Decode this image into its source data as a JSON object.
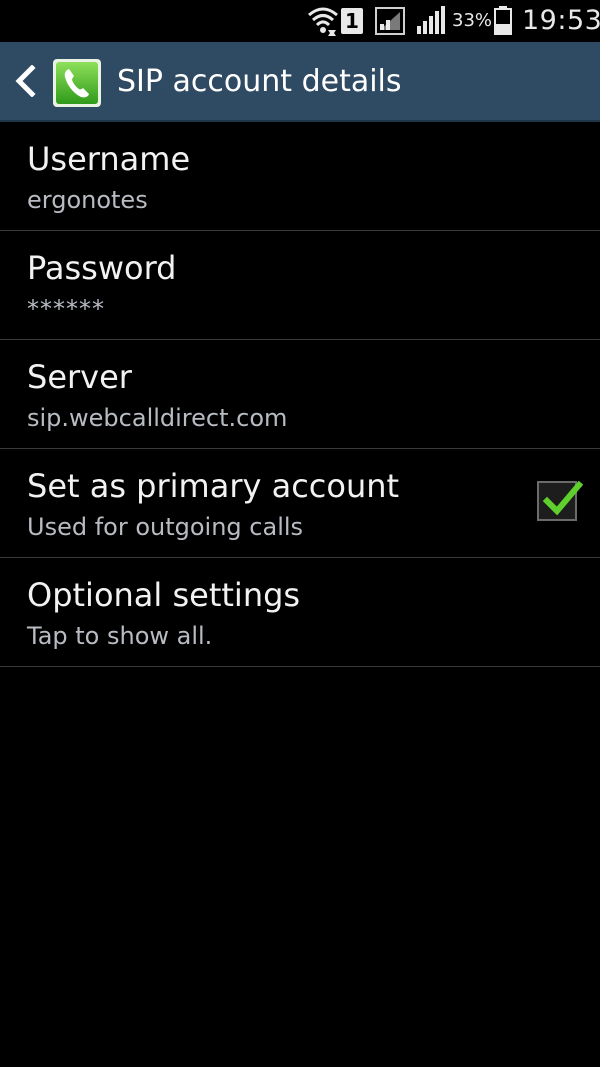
{
  "status_bar": {
    "sim_slot": "1",
    "battery_percent": "33%",
    "time": "19:53",
    "icons": [
      "wifi-icon",
      "signal-icon",
      "signal-icon",
      "battery-icon"
    ]
  },
  "action_bar": {
    "title": "SIP account details",
    "back_icon": "chevron-left-icon",
    "app_icon": "phone-icon"
  },
  "preferences": [
    {
      "title": "Username",
      "summary": "ergonotes"
    },
    {
      "title": "Password",
      "summary": "******"
    },
    {
      "title": "Server",
      "summary": "sip.webcalldirect.com"
    },
    {
      "title": "Set as primary account",
      "summary": "Used for outgoing calls",
      "checked": true
    },
    {
      "title": "Optional settings",
      "summary": "Tap to show all."
    }
  ],
  "colors": {
    "action_bar_bg": "#2f4a63",
    "checkmark": "#5fcf2d",
    "summary_text": "#b8bcc2"
  }
}
